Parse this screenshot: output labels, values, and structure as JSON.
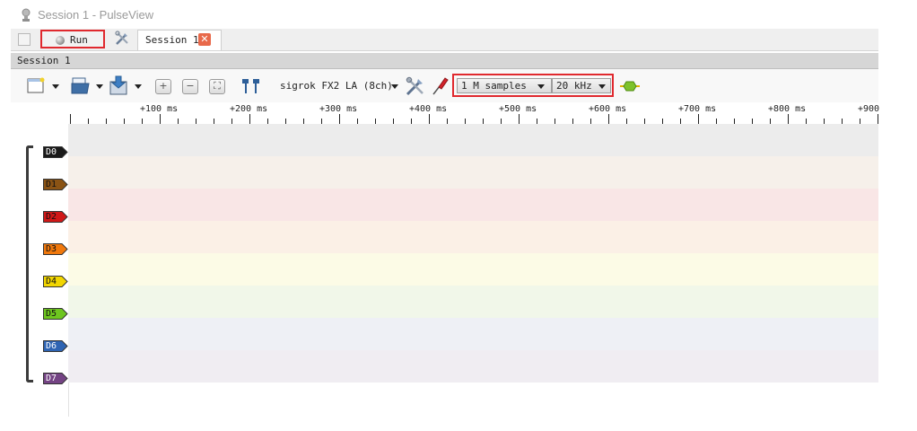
{
  "window": {
    "title": "Session 1 - PulseView",
    "app_icon": "pulseview-icon"
  },
  "tabs": {
    "run_label": "Run",
    "session_tab_label": "Session 1",
    "close_icon": "close-icon"
  },
  "session": {
    "header_label": "Session 1"
  },
  "toolbar": {
    "device_label": "sigrok FX2 LA (8ch)",
    "sample_count": "1 M samples",
    "sample_rate": "20 kHz"
  },
  "ruler": {
    "labels": [
      "+100 ms",
      "+200 ms",
      "+300 ms",
      "+400 ms",
      "+500 ms",
      "+600 ms",
      "+700 ms",
      "+800 ms",
      "+900"
    ]
  },
  "channels": [
    {
      "name": "D0",
      "color": "#1a1a1a",
      "text_color": "#ffffff",
      "lane_color": "#ececec"
    },
    {
      "name": "D1",
      "color": "#8a5314",
      "text_color": "#111111",
      "lane_color": "#f6f0ea"
    },
    {
      "name": "D2",
      "color": "#d01818",
      "text_color": "#111111",
      "lane_color": "#f9e6e6"
    },
    {
      "name": "D3",
      "color": "#f0780c",
      "text_color": "#111111",
      "lane_color": "#fbf0e6"
    },
    {
      "name": "D4",
      "color": "#f2d600",
      "text_color": "#111111",
      "lane_color": "#fcfbe6"
    },
    {
      "name": "D5",
      "color": "#6ec61f",
      "text_color": "#111111",
      "lane_color": "#f1f7e9"
    },
    {
      "name": "D6",
      "color": "#2e64b3",
      "text_color": "#ffffff",
      "lane_color": "#eef0f5"
    },
    {
      "name": "D7",
      "color": "#744384",
      "text_color": "#ffffff",
      "lane_color": "#f0edf2"
    }
  ],
  "colors": {
    "highlight": "#e0292e"
  }
}
